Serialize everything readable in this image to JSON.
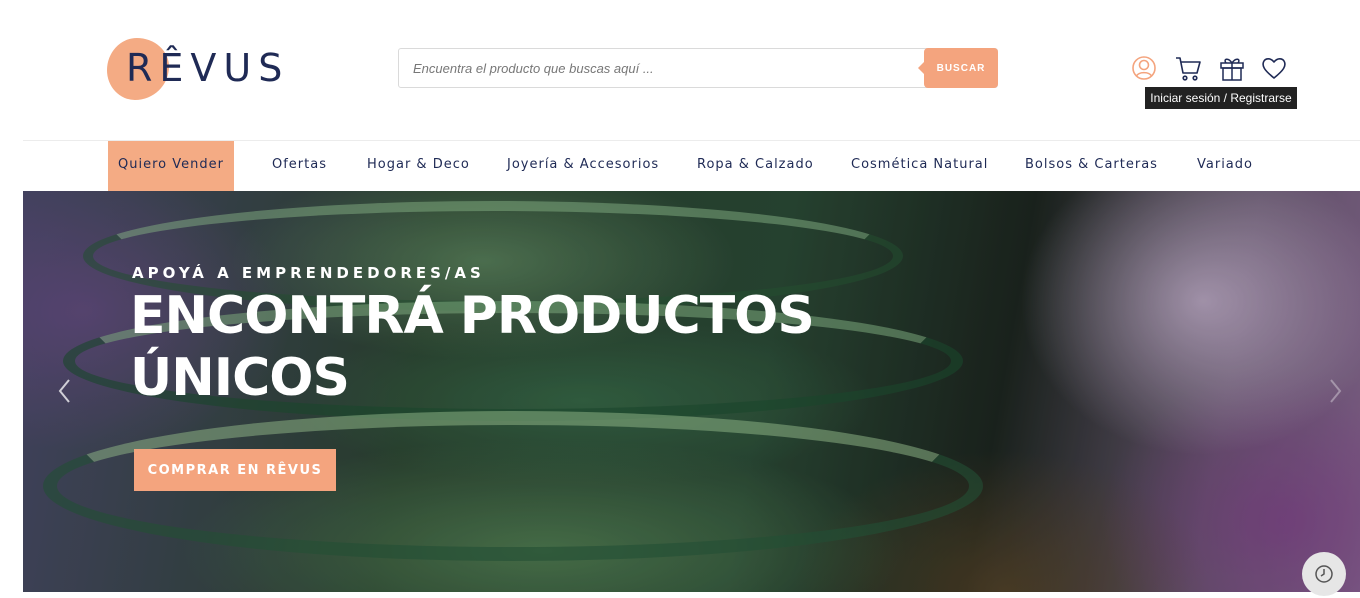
{
  "brand": {
    "logo_text": "RÊVUS",
    "accent_color": "#f4a47e",
    "navy_color": "#1f2a55"
  },
  "search": {
    "placeholder": "Encuentra el producto que buscas aquí ...",
    "button_label": "BUSCAR"
  },
  "header_icons": {
    "user": "user-icon",
    "cart": "cart-icon",
    "gift": "gift-icon",
    "wishlist": "heart-icon",
    "tooltip": "Iniciar sesión / Registrarse"
  },
  "nav": {
    "items": [
      {
        "label": "Quiero Vender",
        "active": true
      },
      {
        "label": "Ofertas"
      },
      {
        "label": "Hogar & Deco"
      },
      {
        "label": "Joyería & Accesorios"
      },
      {
        "label": "Ropa & Calzado"
      },
      {
        "label": "Cosmética Natural"
      },
      {
        "label": "Bolsos & Carteras"
      },
      {
        "label": "Variado"
      }
    ]
  },
  "hero": {
    "kicker": "APOYÁ A EMPRENDEDORES/AS",
    "title": "ENCONTRÁ PRODUCTOS ÚNICOS",
    "cta_label": "COMPRAR EN RÊVUS",
    "prev_icon": "chevron-left-icon",
    "next_icon": "chevron-right-icon"
  },
  "floating": {
    "history_icon": "clock-icon"
  }
}
